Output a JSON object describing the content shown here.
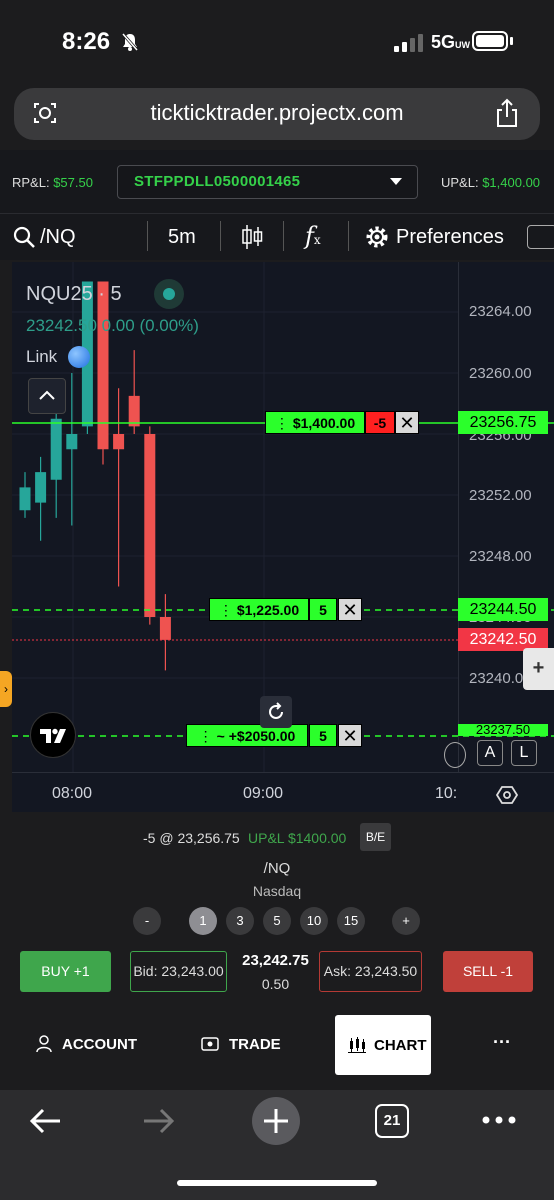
{
  "status_bar": {
    "time": "8:26",
    "network": "5G",
    "network_sub": "UW"
  },
  "browser": {
    "url": "tickticktrader.projectx.com",
    "tab_count": "21"
  },
  "account_bar": {
    "rpl_label": "RP&L:",
    "rpl_value": "$57.50",
    "account_id": "STFPPDLL0500001465",
    "upl_label": "UP&L:",
    "upl_value": "$1,400.00"
  },
  "chart_toolbar": {
    "symbol": "/NQ",
    "interval": "5m",
    "preferences_label": "Preferences"
  },
  "chart": {
    "symbol_title": "NQU25 · 5",
    "quote_line": "23242.50  0.00 (0.00%)",
    "link_label": "Link",
    "price_ticks": [
      "23264.00",
      "23260.00",
      "23256.00",
      "23252.00",
      "23248.00",
      "23244.00",
      "23240.00"
    ],
    "time_ticks": [
      "08:00",
      "09:00",
      "10:"
    ],
    "orders": [
      {
        "pnl": "$1,400.00",
        "qty": "-5",
        "price_tag": "23256.75"
      },
      {
        "pnl": "$1,225.00",
        "qty": "5",
        "price_tag": "23244.50"
      },
      {
        "pnl": "~ +$2050.00",
        "qty": "5",
        "price_tag": "23237.50"
      }
    ],
    "last_price_tag": "23242.50",
    "plus_label": "+",
    "auto_label": "A",
    "log_label": "L",
    "close_symbol": "✕"
  },
  "chart_data": {
    "type": "candlestick",
    "x_label": "",
    "y_label": "",
    "ylim": [
      23238.0,
      23266.0
    ],
    "candles": [
      {
        "o": 23251.0,
        "h": 23253.5,
        "l": 23250.5,
        "c": 23252.5,
        "dir": "up"
      },
      {
        "o": 23251.5,
        "h": 23254.5,
        "l": 23249.0,
        "c": 23253.5,
        "dir": "up"
      },
      {
        "o": 23253.0,
        "h": 23258.0,
        "l": 23250.5,
        "c": 23257.0,
        "dir": "up"
      },
      {
        "o": 23255.0,
        "h": 23260.0,
        "l": 23250.0,
        "c": 23256.0,
        "dir": "up"
      },
      {
        "o": 23256.5,
        "h": 23266.0,
        "l": 23256.0,
        "c": 23266.0,
        "dir": "up"
      },
      {
        "o": 23266.0,
        "h": 23266.0,
        "l": 23254.0,
        "c": 23255.0,
        "dir": "down"
      },
      {
        "o": 23256.0,
        "h": 23259.0,
        "l": 23246.0,
        "c": 23255.0,
        "dir": "down"
      },
      {
        "o": 23258.5,
        "h": 23261.5,
        "l": 23256.0,
        "c": 23256.5,
        "dir": "down"
      },
      {
        "o": 23256.0,
        "h": 23256.5,
        "l": 23243.5,
        "c": 23244.0,
        "dir": "down"
      },
      {
        "o": 23244.0,
        "h": 23245.5,
        "l": 23240.5,
        "c": 23242.5,
        "dir": "down"
      }
    ],
    "colors": {
      "up": "#26a69a",
      "down": "#ef5350",
      "order_green": "#2bff2b",
      "last_red": "#f23645"
    }
  },
  "position_panel": {
    "position_text": "-5 @ 23,256.75",
    "upl_text": "UP&L $1400.00",
    "be_label": "B/E",
    "symbol": "/NQ",
    "exchange": "Nasdaq",
    "qty_options": [
      "-",
      "1",
      "3",
      "5",
      "10",
      "15",
      "+"
    ],
    "selected_qty": "1",
    "buy_label": "BUY +1",
    "bid_text": "Bid: 23,243.00",
    "mid_price": "23,242.75",
    "spread": "0.50",
    "ask_text": "Ask: 23,243.50",
    "sell_label": "SELL -1"
  },
  "bottom_tabs": {
    "account": "ACCOUNT",
    "trade": "TRADE",
    "chart": "CHART",
    "more": "···"
  }
}
